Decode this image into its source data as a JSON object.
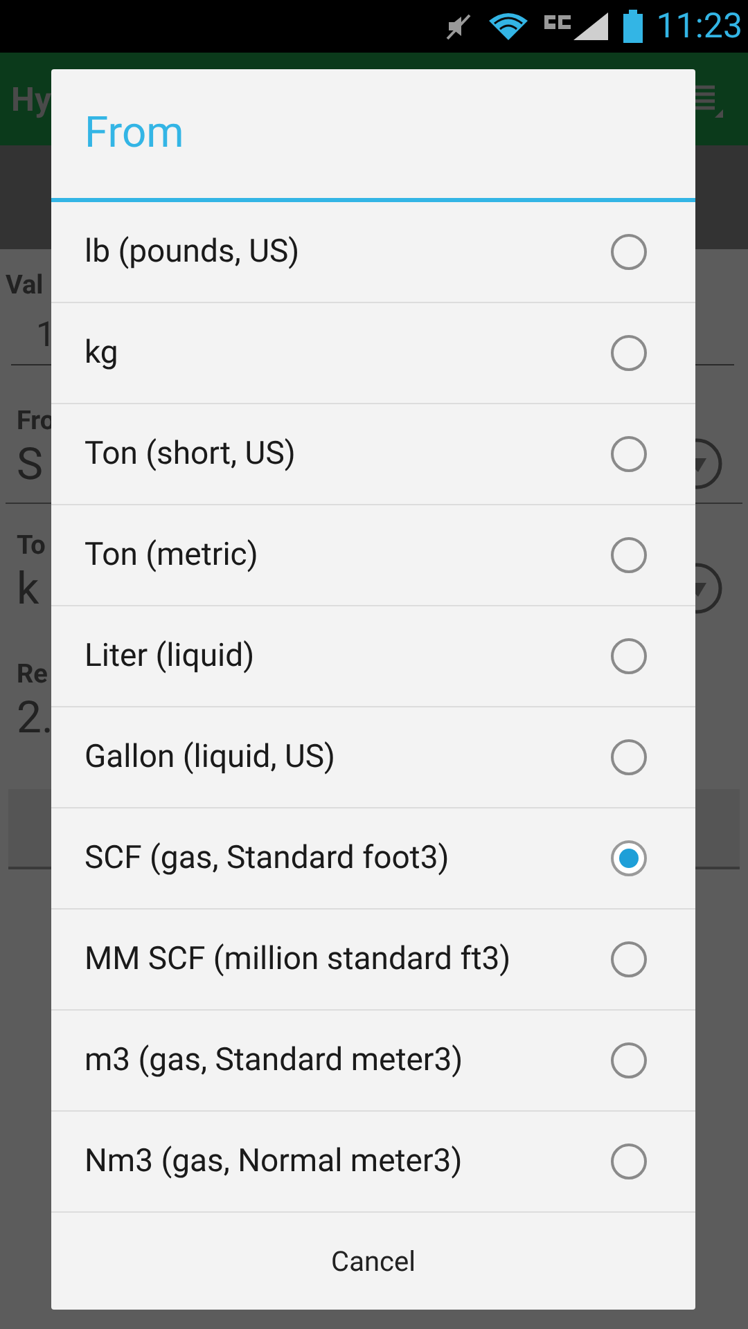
{
  "status_bar": {
    "time": "11:23"
  },
  "app_bar": {
    "title": "Hy"
  },
  "background_form": {
    "value_label": "Val",
    "value": "1",
    "from_label": "Fro",
    "from_value": "S",
    "to_label": "To",
    "to_value": "k",
    "result_label": "Re",
    "result_value": "2."
  },
  "dialog": {
    "title": "From",
    "items": [
      {
        "label": "lb (pounds, US)",
        "selected": false
      },
      {
        "label": "kg",
        "selected": false
      },
      {
        "label": "Ton (short, US)",
        "selected": false
      },
      {
        "label": "Ton (metric)",
        "selected": false
      },
      {
        "label": "Liter (liquid)",
        "selected": false
      },
      {
        "label": "Gallon (liquid, US)",
        "selected": false
      },
      {
        "label": "SCF (gas, Standard foot3)",
        "selected": true
      },
      {
        "label": "MM SCF (million standard ft3)",
        "selected": false
      },
      {
        "label": "m3 (gas, Standard meter3)",
        "selected": false
      },
      {
        "label": "Nm3 (gas, Normal meter3)",
        "selected": false
      }
    ],
    "cancel": "Cancel"
  }
}
